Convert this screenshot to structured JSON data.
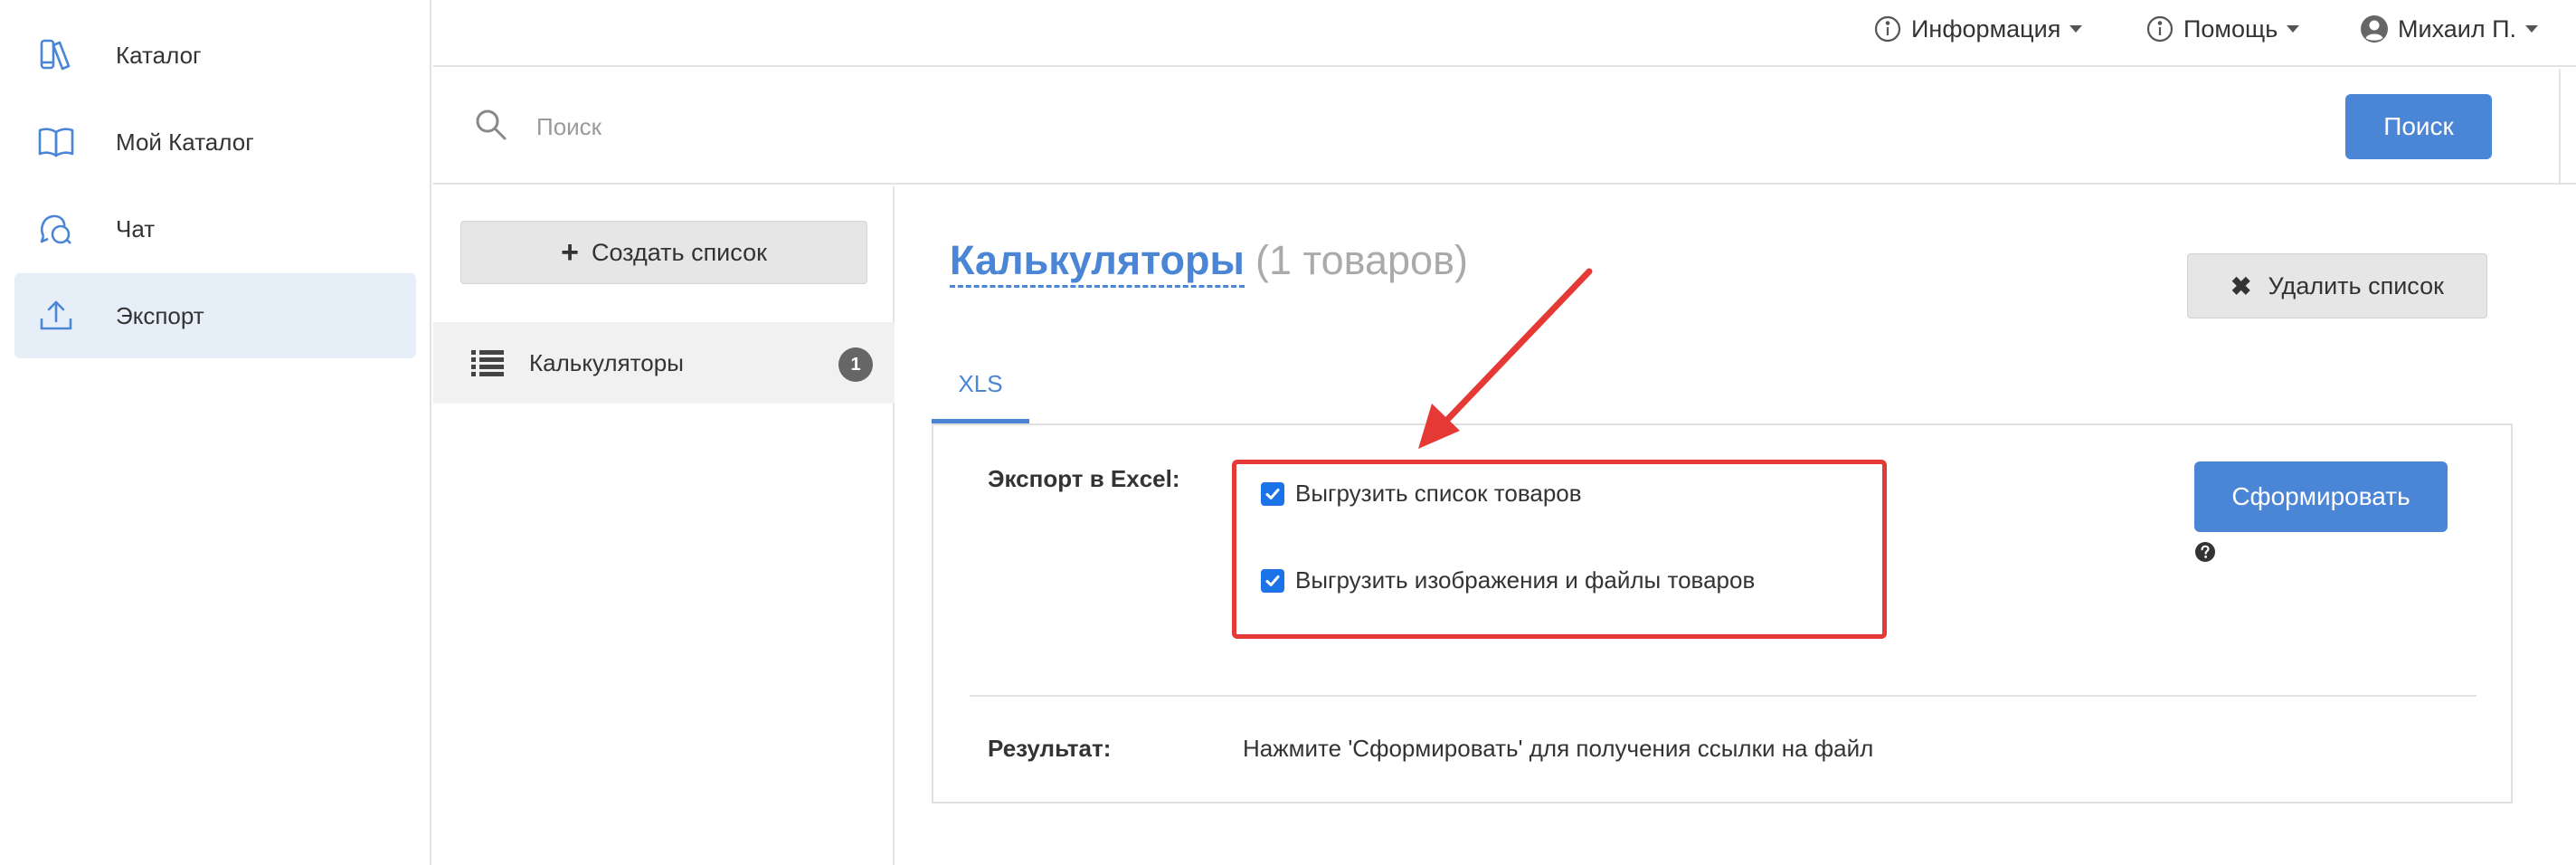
{
  "sidebar": {
    "items": [
      {
        "label": "Каталог",
        "icon": "catalog-icon",
        "active": false
      },
      {
        "label": "Мой Каталог",
        "icon": "book-icon",
        "active": false
      },
      {
        "label": "Чат",
        "icon": "chat-icon",
        "active": false
      },
      {
        "label": "Экспорт",
        "icon": "export-icon",
        "active": true
      }
    ]
  },
  "topbar": {
    "info_label": "Информация",
    "help_label": "Помощь",
    "user_label": "Михаил П."
  },
  "search": {
    "placeholder": "Поиск",
    "value": "",
    "button_label": "Поиск"
  },
  "lists": {
    "create_label": "Создать список",
    "items": [
      {
        "name": "Калькуляторы",
        "count": "1",
        "selected": true
      }
    ]
  },
  "main": {
    "title": "Калькуляторы",
    "title_count": "(1 товаров)",
    "delete_label": "Удалить список",
    "tabs": [
      {
        "label": "XLS",
        "active": true
      }
    ],
    "export": {
      "label": "Экспорт в Excel:",
      "options": [
        {
          "label": "Выгрузить список товаров",
          "checked": true
        },
        {
          "label": "Выгрузить изображения и файлы товаров",
          "checked": true
        }
      ],
      "generate_label": "Сформировать",
      "result_label": "Результат:",
      "result_text": "Нажмите 'Сформировать' для получения ссылки на файл"
    }
  },
  "colors": {
    "accent": "#4a85d6",
    "active_nav_bg": "#e6eef8",
    "annotation_red": "#e53935",
    "checkbox": "#1a73e8"
  }
}
